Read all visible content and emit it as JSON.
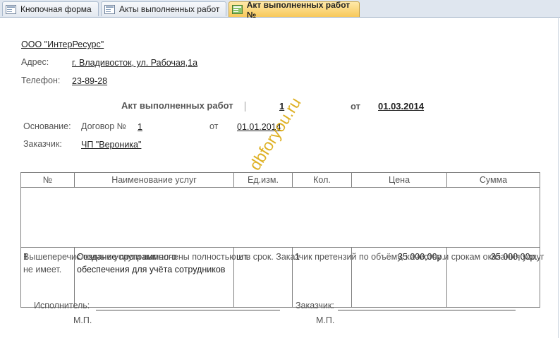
{
  "tabs": [
    {
      "label": "Кнопочная форма",
      "icon": "form-icon"
    },
    {
      "label": "Акты выполненных работ",
      "icon": "form-icon"
    },
    {
      "label": "Акт выполненных работ №",
      "icon": "report-icon",
      "active": true
    }
  ],
  "company": {
    "name": "ООО \"ИнтерРесурс\"",
    "address_label": "Адрес:",
    "address": "г. Владивосток, ул.  Рабочая,1а",
    "phone_label": "Телефон:",
    "phone": "23-89-28"
  },
  "act": {
    "title": "Акт выполненных работ",
    "number": "1",
    "from_label": "от",
    "date": "01.03.2014"
  },
  "basis": {
    "label": "Основание:",
    "contract_label": "Договор №",
    "contract_number": "1",
    "from_label": "от",
    "date": "01.01.2014"
  },
  "customer": {
    "label": "Заказчик:",
    "name": "ЧП \"Вероника\""
  },
  "table": {
    "headers": [
      "№",
      "Наименование услуг",
      "Ед.изм.",
      "Кол.",
      "Цена",
      "Сумма"
    ],
    "rows": [
      {
        "n": "1",
        "name": "Создание программного обеспечения для учёта сотрудников",
        "unit": "шт.",
        "qty": "1",
        "price": "35 000,00р.",
        "sum": "35 000,00р."
      }
    ]
  },
  "note": "Вышеперечисленные услуги выполнены полностью и в срок. Заказчик претензий по объёму, качеству и срокам оказания услуг не имеет.",
  "signatures": {
    "executor_label": "Исполнитель:",
    "customer_label": "Заказчик:",
    "stamp": "М.П."
  },
  "watermark": "dbforyou.ru"
}
